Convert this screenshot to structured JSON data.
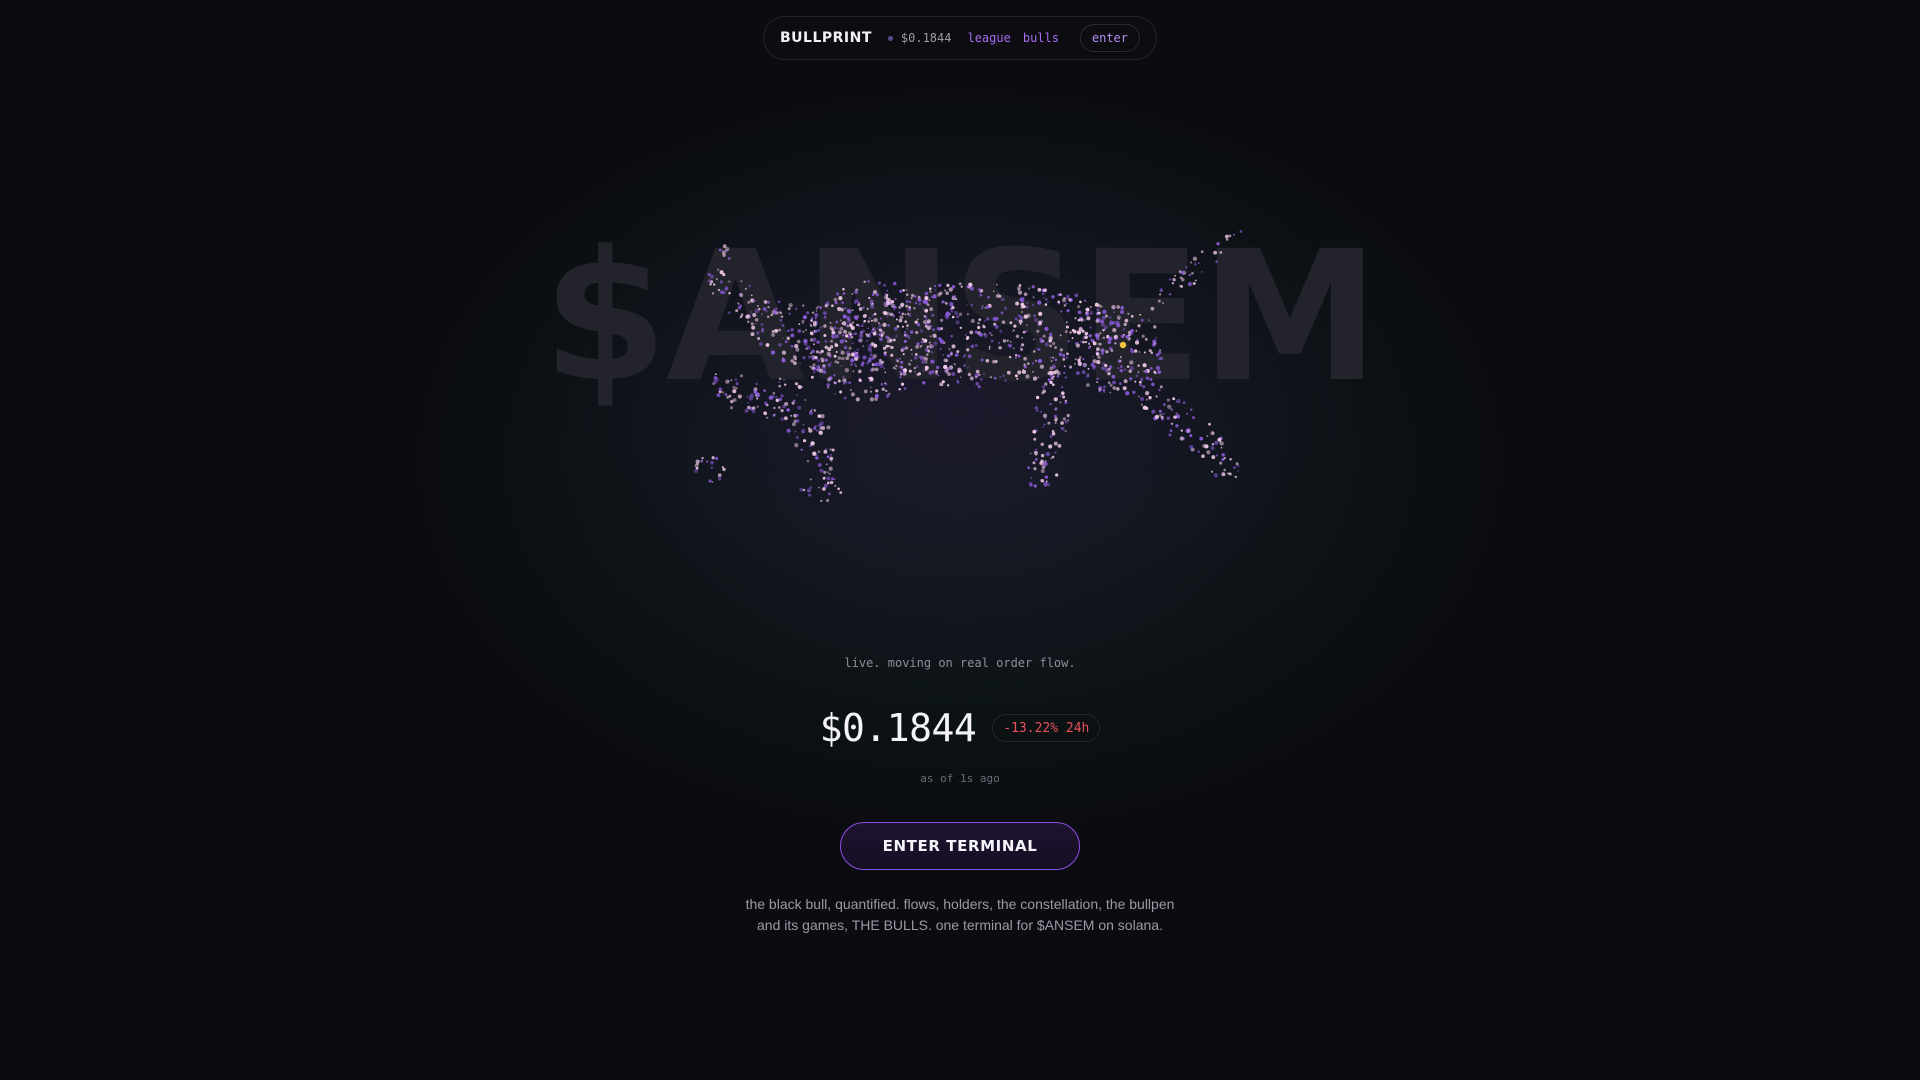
{
  "nav": {
    "brand": "BULLPRINT",
    "price": "$0.1844",
    "links": [
      "league",
      "bulls"
    ],
    "enter_label": "enter"
  },
  "hero": {
    "ticker_text": "$ANSEM",
    "tagline": "live. moving on real order flow.",
    "price": "$0.1844",
    "change": "-13.22% 24h",
    "as_of": "as of 1s ago",
    "cta_label": "ENTER TERMINAL",
    "blurb_lines": [
      "the black bull, quantified. flows, holders, the constellation, the bullpen",
      "and its games, THE BULLS. one terminal for $ANSEM on solana."
    ]
  },
  "colors": {
    "background": "#0b0b10",
    "accent": "#a66cf0",
    "negative": "#e8505a",
    "particle_pink": "#f0c8e8",
    "particle_purple": "#8a5ad8",
    "particle_gold": "#f5c542"
  },
  "icons": {
    "status_dot": "dot-icon"
  }
}
